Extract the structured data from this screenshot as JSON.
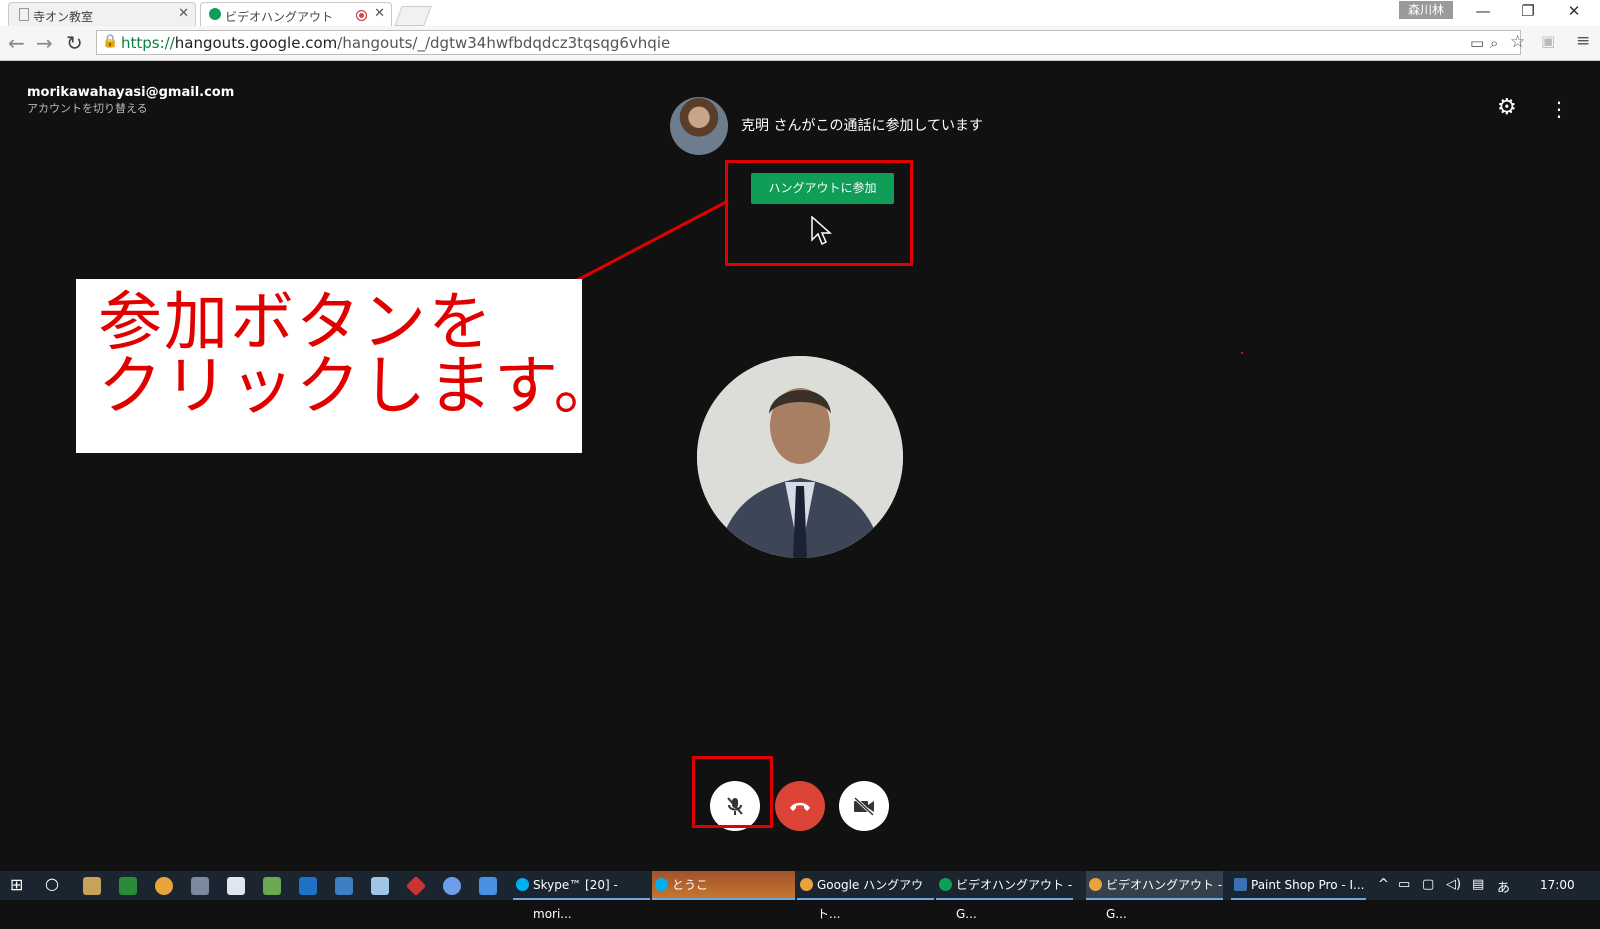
{
  "browser": {
    "tabs": [
      {
        "label": "寺オン教室",
        "active": false
      },
      {
        "label": "ビデオハングアウト",
        "active": true
      }
    ],
    "profile": "森川林",
    "url": {
      "scheme": "https://",
      "host": "hangouts.google.com",
      "path": "/hangouts/_/dgtw34hwfbdqdcz3tqsqg6vhqie"
    }
  },
  "account": {
    "email": "morikawahayasi@gmail.com",
    "switch_label": "アカウントを切り替える"
  },
  "call": {
    "caller_message": "克明 さんがこの通話に参加しています",
    "join_button": "ハングアウトに参加"
  },
  "annotation": {
    "text": "参加ボタンを\nクリックします。",
    "color": "#e00000"
  },
  "controls": {
    "mute_icon": "mic-off-icon",
    "hangup_icon": "phone-hangup-icon",
    "video_icon": "video-off-icon"
  },
  "taskbar": {
    "tasks": [
      {
        "label": "Skype™ [20] - mori...",
        "color": "#00aff0"
      },
      {
        "label": "とうこ",
        "color": "#00aff0"
      },
      {
        "label": "Google ハングアウト...",
        "color": "#e8a33d"
      },
      {
        "label": "ビデオハングアウト - G...",
        "color": "#0f9d58"
      },
      {
        "label": "ビデオハングアウト - G...",
        "color": "#e8a33d"
      },
      {
        "label": "Paint Shop Pro - I...",
        "color": "#3b6fb6"
      }
    ],
    "ime": "あ",
    "time": "17:00"
  },
  "colors": {
    "join_green": "#0f9d58",
    "hangup_red": "#db4437",
    "highlight_red": "#e00000"
  }
}
